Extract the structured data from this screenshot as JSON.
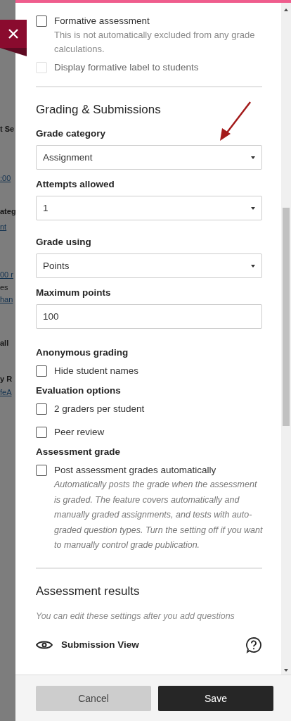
{
  "background_page": {
    "fragments": [
      {
        "text": "t Se",
        "kind": "heading"
      },
      {
        "text": ":00",
        "kind": "link"
      },
      {
        "text": "ateg",
        "kind": "label"
      },
      {
        "text": "nt",
        "kind": "link"
      },
      {
        "text": "00 r",
        "kind": "link"
      },
      {
        "text": "es",
        "kind": "text"
      },
      {
        "text": "han",
        "kind": "link"
      },
      {
        "text": "all",
        "kind": "label"
      },
      {
        "text": "y R",
        "kind": "label"
      },
      {
        "text": "feA",
        "kind": "link"
      }
    ]
  },
  "formative": {
    "label": "Formative assessment",
    "checked": false,
    "disabled": false,
    "description": "This is not automatically excluded from any grade calculations."
  },
  "display_formative": {
    "label": "Display formative label to students",
    "checked": false,
    "disabled": true
  },
  "grading": {
    "title": "Grading & Submissions",
    "fields": [
      {
        "kind": "select",
        "label": "Grade category",
        "value": "Assignment"
      },
      {
        "kind": "select",
        "label": "Attempts allowed",
        "value": "1"
      },
      {
        "kind": "select",
        "label": "Grade using",
        "value": "Points"
      },
      {
        "kind": "input",
        "label": "Maximum points",
        "value": "100"
      }
    ],
    "groups": [
      {
        "title": "Anonymous grading",
        "options": [
          {
            "label": "Hide student names",
            "checked": false
          }
        ]
      },
      {
        "title": "Evaluation options",
        "options": [
          {
            "label": "2 graders per student",
            "checked": false
          },
          {
            "label": "Peer review",
            "checked": false
          }
        ]
      },
      {
        "title": "Assessment grade",
        "options": [
          {
            "label": "Post assessment grades automatically",
            "checked": false,
            "description": "Automatically posts the grade when the assessment is graded. The feature covers automatically and manually graded assignments, and tests with auto-graded question types. Turn the setting off if you want to manually control grade publication."
          }
        ]
      }
    ]
  },
  "results": {
    "title": "Assessment results",
    "note": "You can edit these settings after you add questions",
    "items": [
      {
        "label": "Submission View"
      }
    ]
  },
  "footer": {
    "buttons": [
      {
        "label": "Cancel",
        "kind": "secondary"
      },
      {
        "label": "Save",
        "kind": "primary"
      }
    ]
  }
}
